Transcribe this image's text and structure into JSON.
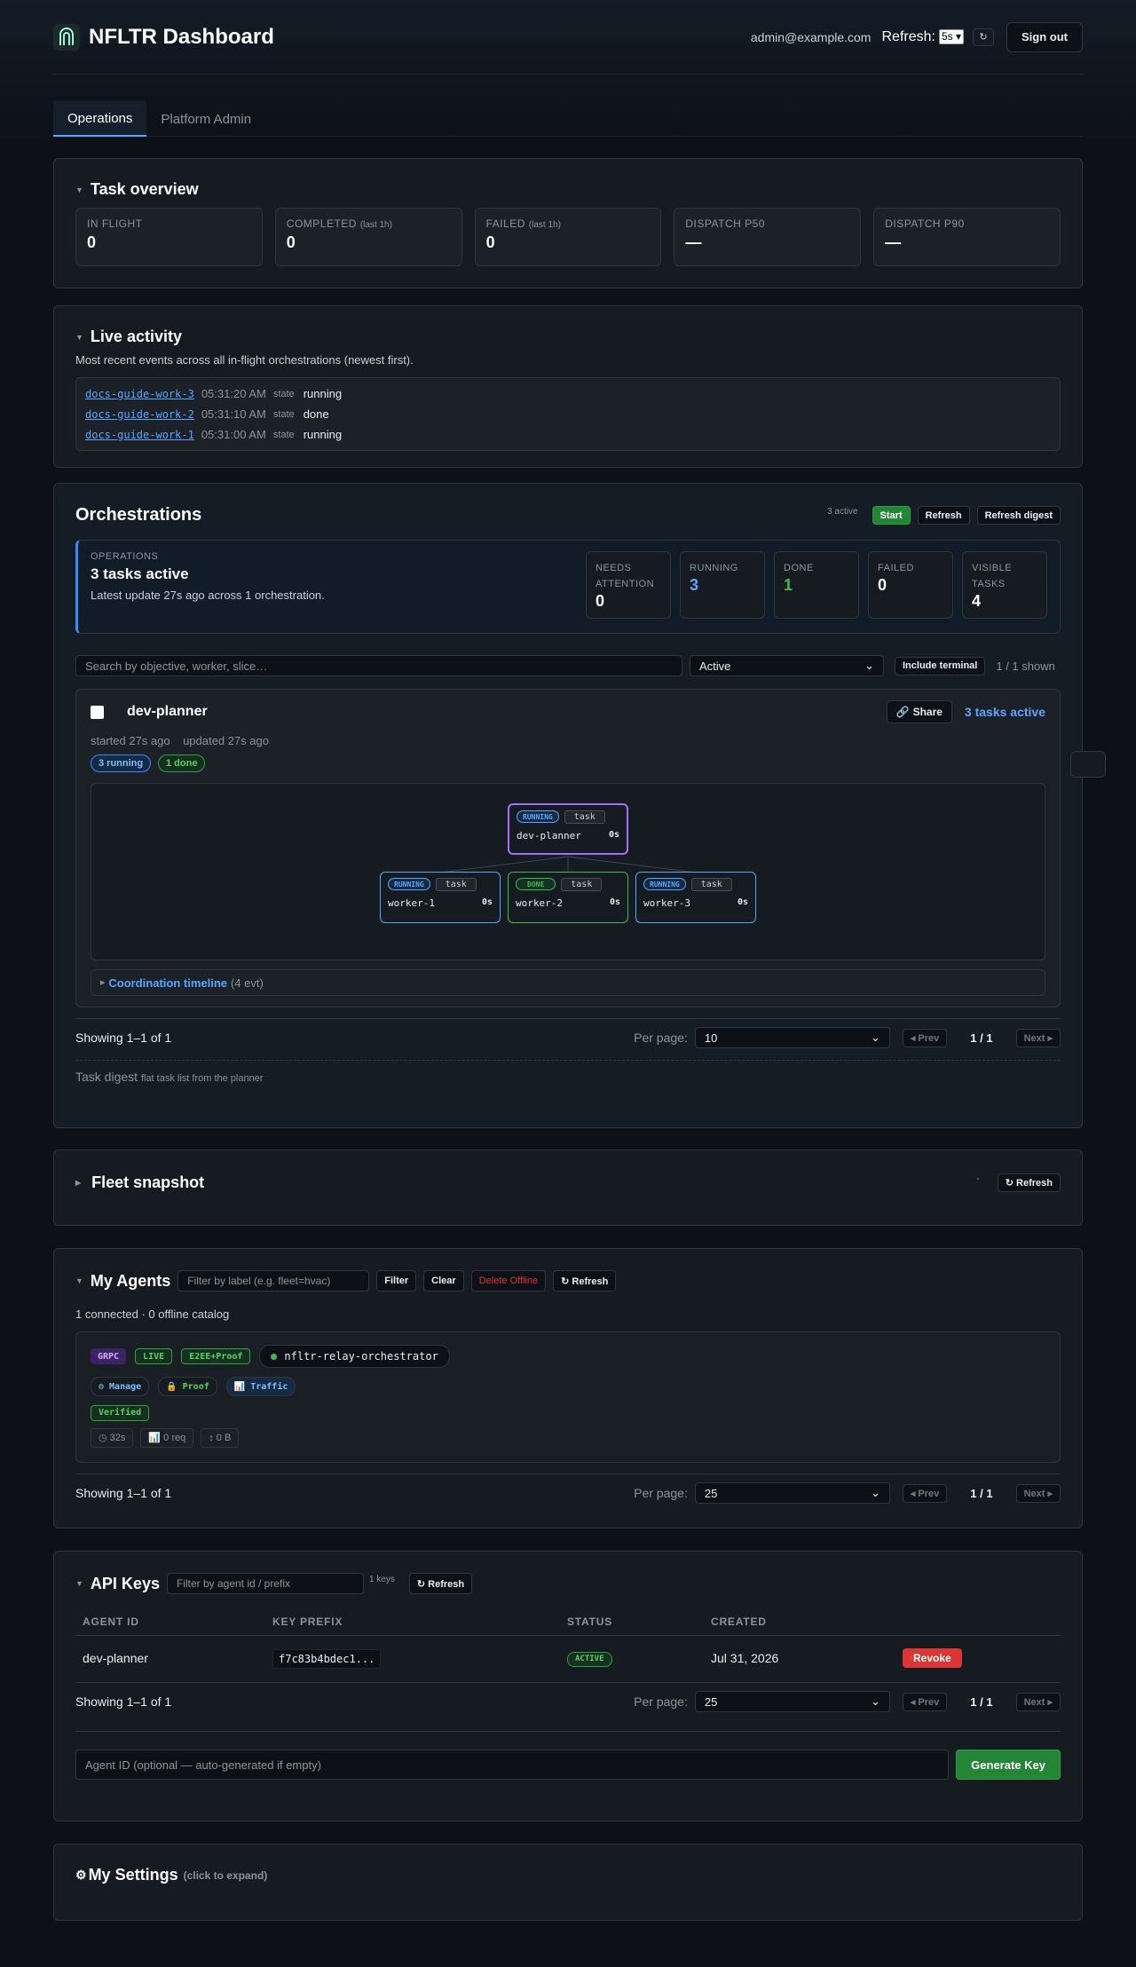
{
  "header": {
    "title": "NFLTR Dashboard",
    "email": "admin@example.com",
    "refresh_label": "Refresh:",
    "refresh_value": "5s",
    "refresh_icon": "↻",
    "signout": "Sign out"
  },
  "tabs": [
    "Operations",
    "Platform Admin"
  ],
  "task_overview": {
    "title": "Task overview",
    "stats": [
      {
        "label": "IN FLIGHT",
        "note": "",
        "value": "0"
      },
      {
        "label": "COMPLETED",
        "note": "(last 1h)",
        "value": "0"
      },
      {
        "label": "FAILED",
        "note": "(last 1h)",
        "value": "0"
      },
      {
        "label": "DISPATCH P50",
        "note": "",
        "value": "—"
      },
      {
        "label": "DISPATCH P90",
        "note": "",
        "value": "—"
      }
    ]
  },
  "live_activity": {
    "title": "Live activity",
    "subtitle": "Most recent events across all in-flight orchestrations (newest first).",
    "events": [
      {
        "id": "docs-guide-work-3",
        "time": "05:31:20 AM",
        "key": "state",
        "value": "running"
      },
      {
        "id": "docs-guide-work-2",
        "time": "05:31:10 AM",
        "key": "state",
        "value": "done"
      },
      {
        "id": "docs-guide-work-1",
        "time": "05:31:00 AM",
        "key": "state",
        "value": "running"
      }
    ]
  },
  "orchestrations": {
    "title": "Orchestrations",
    "active_count": "3 active",
    "start": "Start",
    "refresh": "Refresh",
    "refresh_digest": "Refresh digest",
    "ops": {
      "label": "OPERATIONS",
      "headline": "3 tasks active",
      "detail": "Latest update 27s ago across 1 orchestration.",
      "mini": [
        {
          "label": "NEEDS ATTENTION",
          "value": "0",
          "color": "#ffffff"
        },
        {
          "label": "RUNNING",
          "value": "3",
          "color": "#58a6ff"
        },
        {
          "label": "DONE",
          "value": "1",
          "color": "#3fb950"
        },
        {
          "label": "FAILED",
          "value": "0",
          "color": "#ffffff"
        },
        {
          "label": "VISIBLE TASKS",
          "value": "4",
          "color": "#ffffff"
        }
      ]
    },
    "search_placeholder": "Search by objective, worker, slice…",
    "filter_value": "Active",
    "include_terminal": "Include terminal",
    "shown": "1 / 1 shown",
    "item": {
      "name": "dev-planner",
      "share": "Share",
      "status": "3 tasks active",
      "started": "started 27s ago",
      "updated": "updated 27s ago",
      "pills": [
        "3 running",
        "1 done"
      ],
      "nodes": [
        {
          "status": "RUNNING",
          "tag": "task",
          "name": "dev-planner",
          "dur": "0s"
        },
        {
          "status": "RUNNING",
          "tag": "task",
          "name": "worker-1",
          "dur": "0s"
        },
        {
          "status": "DONE",
          "tag": "task",
          "name": "worker-2",
          "dur": "0s"
        },
        {
          "status": "RUNNING",
          "tag": "task",
          "name": "worker-3",
          "dur": "0s"
        }
      ],
      "timeline_label": "Coordination timeline",
      "timeline_count": "(4 evt)"
    },
    "pager": {
      "showing": "Showing 1–1 of 1",
      "per_page_label": "Per page:",
      "per_page": "10",
      "prev": "◂ Prev",
      "page": "1 / 1",
      "next": "Next ▸"
    },
    "digest_title": "Task digest",
    "digest_note": "flat task list from the planner"
  },
  "fleet": {
    "title": "Fleet snapshot",
    "dot": "-",
    "refresh": "↻ Refresh"
  },
  "agents": {
    "title": "My Agents",
    "filter_placeholder": "Filter by label (e.g. fleet=hvac)",
    "filter": "Filter",
    "clear": "Clear",
    "delete_offline": "Delete Offline",
    "refresh": "↻ Refresh",
    "summary": "1 connected · 0 offline catalog",
    "agent": {
      "badges": [
        "GRPC",
        "LIVE",
        "E2EE+Proof"
      ],
      "name": "nfltr-relay-orchestrator",
      "actions": [
        "⚙ Manage",
        "🔒 Proof",
        "📊 Traffic"
      ],
      "verified": "Verified",
      "metrics": [
        "◷ 32s",
        "📊 0 req",
        "↕ 0 B"
      ]
    },
    "pager": {
      "showing": "Showing 1–1 of 1",
      "per_page_label": "Per page:",
      "per_page": "25",
      "prev": "◂ Prev",
      "page": "1 / 1",
      "next": "Next ▸"
    }
  },
  "api_keys": {
    "title": "API Keys",
    "filter_placeholder": "Filter by agent id / prefix",
    "count": "1 keys",
    "refresh": "↻ Refresh",
    "columns": [
      "AGENT ID",
      "KEY PREFIX",
      "STATUS",
      "CREATED"
    ],
    "rows": [
      {
        "agent_id": "dev-planner",
        "prefix": "f7c83b4bdec1...",
        "status": "ACTIVE",
        "created": "Jul 31, 2026",
        "action": "Revoke"
      }
    ],
    "pager": {
      "showing": "Showing 1–1 of 1",
      "per_page_label": "Per page:",
      "per_page": "25",
      "prev": "◂ Prev",
      "page": "1 / 1",
      "next": "Next ▸"
    },
    "agent_placeholder": "Agent ID (optional — auto-generated if empty)",
    "generate": "Generate Key"
  },
  "settings": {
    "icon": "⚙",
    "title": "My Settings",
    "hint": "(click to expand)"
  }
}
